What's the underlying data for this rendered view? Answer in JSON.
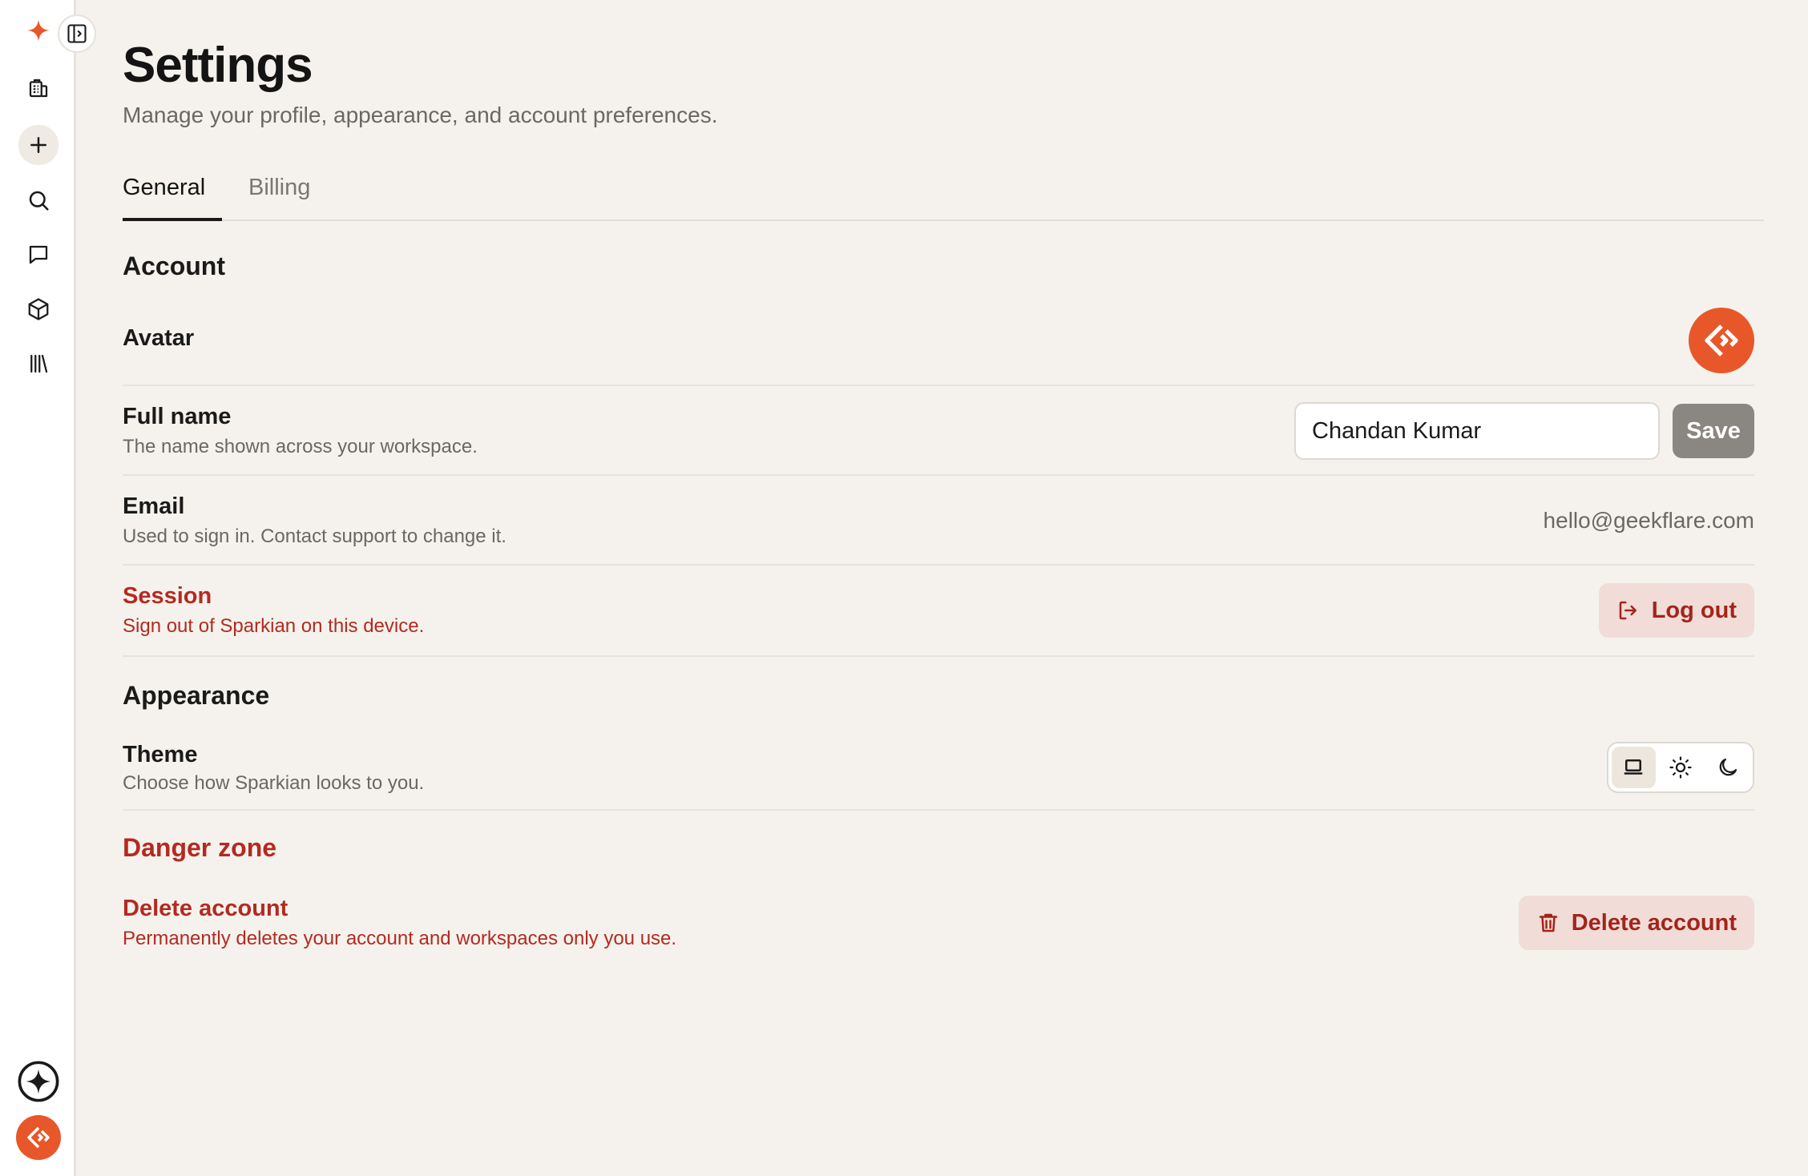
{
  "page": {
    "title": "Settings",
    "subtitle": "Manage your profile, appearance, and account preferences."
  },
  "tabs": [
    {
      "label": "General",
      "active": true
    },
    {
      "label": "Billing",
      "active": false
    }
  ],
  "sidebar": {
    "logo_icon": "sparkle-logo-icon",
    "items": [
      {
        "icon": "building-icon"
      },
      {
        "icon": "plus-icon"
      },
      {
        "icon": "search-icon"
      },
      {
        "icon": "chat-icon"
      },
      {
        "icon": "cube-icon"
      },
      {
        "icon": "library-icon"
      }
    ],
    "bottom": [
      {
        "icon": "sparkle-circle-icon"
      },
      {
        "icon": "user-avatar"
      }
    ]
  },
  "account": {
    "title": "Account",
    "avatar_label": "Avatar",
    "full_name": {
      "label": "Full name",
      "description": "The name shown across your workspace.",
      "value": "Chandan Kumar",
      "save_label": "Save"
    },
    "email": {
      "label": "Email",
      "description": "Used to sign in. Contact support to change it.",
      "value": "hello@geekflare.com"
    },
    "session": {
      "label": "Session",
      "description": "Sign out of Sparkian on this device.",
      "button_label": "Log out"
    }
  },
  "appearance": {
    "title": "Appearance",
    "theme": {
      "label": "Theme",
      "description": "Choose how Sparkian looks to you.",
      "options": [
        "laptop-icon",
        "sun-icon",
        "moon-icon"
      ],
      "selected": "laptop-icon"
    }
  },
  "danger_zone": {
    "title": "Danger zone",
    "delete": {
      "label": "Delete account",
      "description": "Permanently deletes your account and workspaces only you use.",
      "button_label": "Delete account"
    }
  },
  "colors": {
    "accent": "#e8572a",
    "danger": "#b32a22",
    "background": "#f5f2ed"
  }
}
